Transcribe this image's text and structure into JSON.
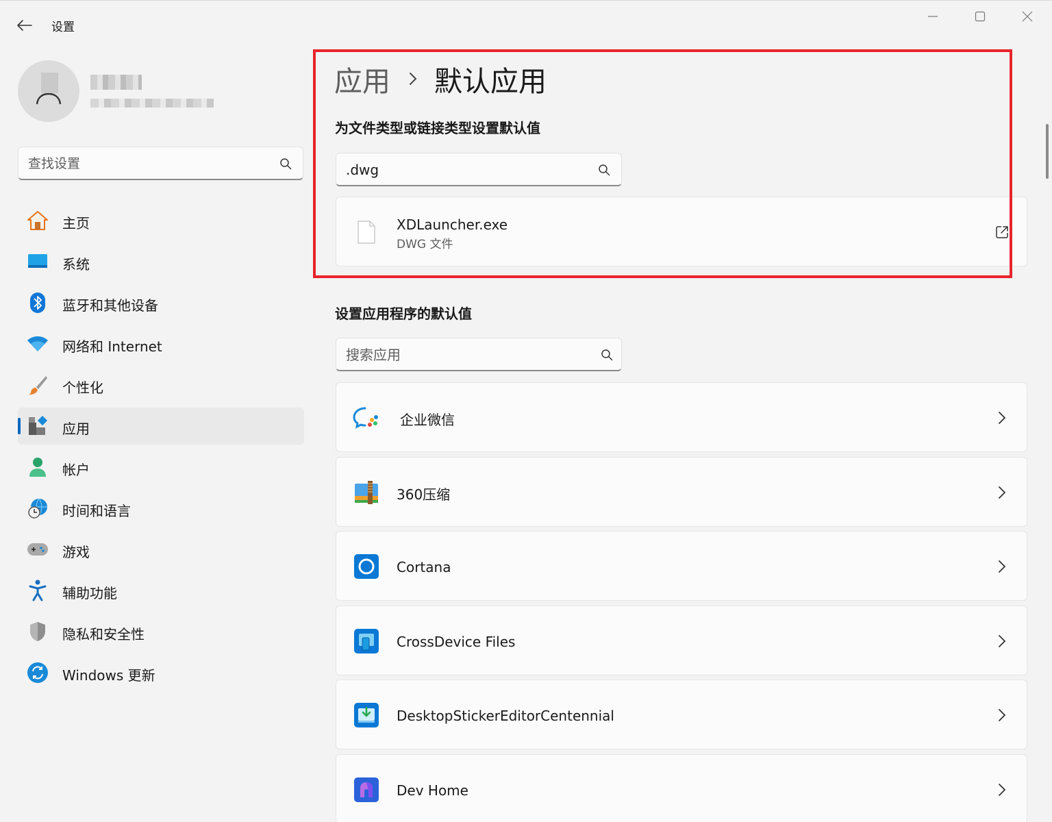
{
  "window": {
    "title": "设置",
    "controls": {
      "minimize": "minimize",
      "maximize": "maximize",
      "close": "close"
    }
  },
  "sidebar": {
    "search_placeholder": "查找设置",
    "items": [
      {
        "label": "主页",
        "icon": "home-icon"
      },
      {
        "label": "系统",
        "icon": "system-icon"
      },
      {
        "label": "蓝牙和其他设备",
        "icon": "bluetooth-icon"
      },
      {
        "label": "网络和 Internet",
        "icon": "wifi-icon"
      },
      {
        "label": "个性化",
        "icon": "brush-icon"
      },
      {
        "label": "应用",
        "icon": "apps-icon",
        "active": true
      },
      {
        "label": "帐户",
        "icon": "account-icon"
      },
      {
        "label": "时间和语言",
        "icon": "globe-clock-icon"
      },
      {
        "label": "游戏",
        "icon": "gamepad-icon"
      },
      {
        "label": "辅助功能",
        "icon": "accessibility-icon"
      },
      {
        "label": "隐私和安全性",
        "icon": "shield-icon"
      },
      {
        "label": "Windows 更新",
        "icon": "update-icon"
      }
    ]
  },
  "main": {
    "breadcrumb": {
      "parent": "应用",
      "current": "默认应用"
    },
    "filetype_section": {
      "title": "为文件类型或链接类型设置默认值",
      "search_value": ".dwg",
      "result": {
        "app": "XDLauncher.exe",
        "type": "DWG 文件"
      }
    },
    "apps_section": {
      "title": "设置应用程序的默认值",
      "search_placeholder": "搜索应用",
      "apps": [
        {
          "name": "企业微信",
          "icon": "wecom-icon"
        },
        {
          "name": "360压缩",
          "icon": "archive-icon"
        },
        {
          "name": "Cortana",
          "icon": "cortana-icon"
        },
        {
          "name": "CrossDevice Files",
          "icon": "crossdevice-icon"
        },
        {
          "name": "DesktopStickerEditorCentennial",
          "icon": "sticker-editor-icon"
        },
        {
          "name": "Dev Home",
          "icon": "devhome-icon"
        }
      ]
    }
  },
  "colors": {
    "accent": "#0067c0",
    "highlight": "#e8242a",
    "background": "#f3f3f3",
    "card": "#fbfbfb"
  }
}
